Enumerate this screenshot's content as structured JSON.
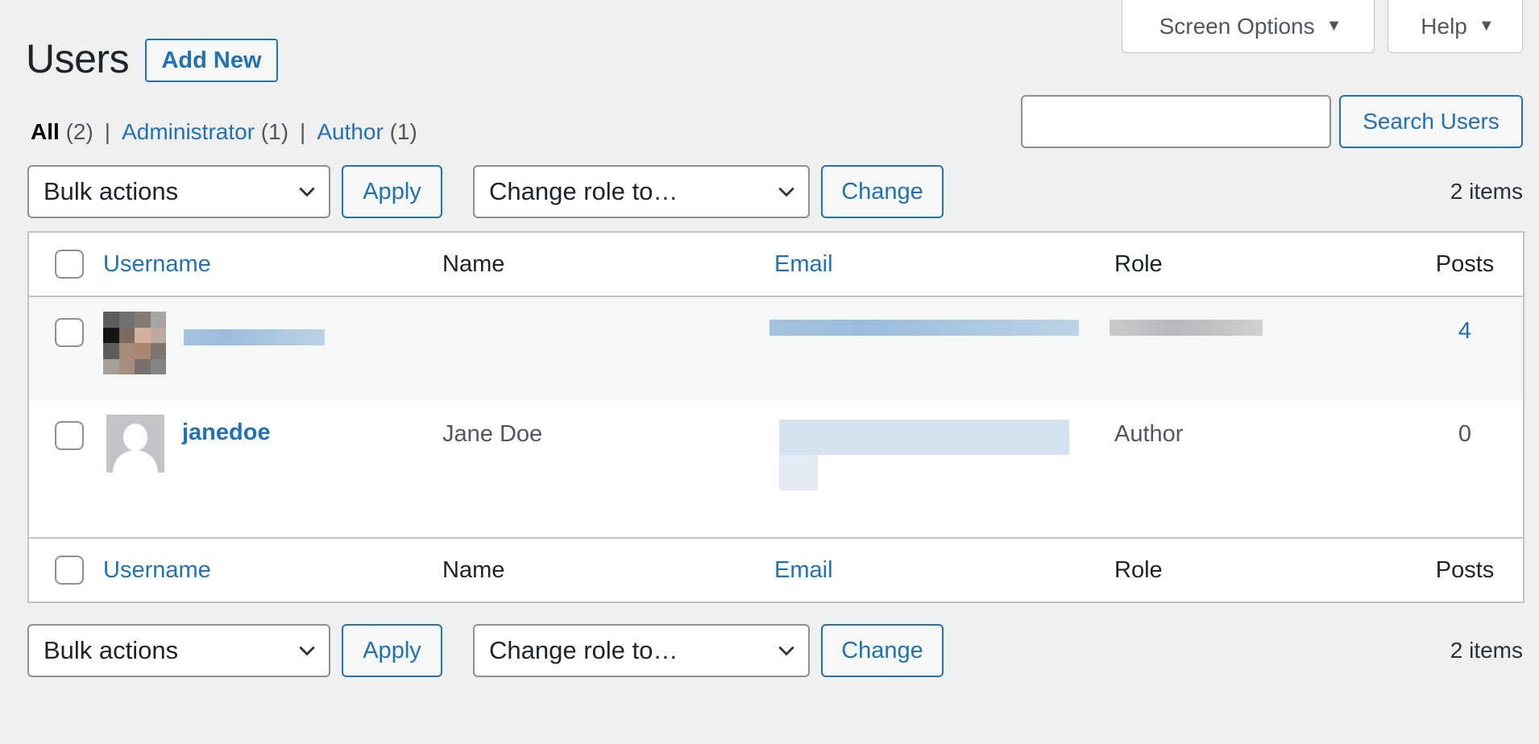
{
  "screen_meta": {
    "screen_options_label": "Screen Options",
    "help_label": "Help",
    "toggle_glyph": "▼"
  },
  "header": {
    "title": "Users",
    "add_new_label": "Add New"
  },
  "filters": [
    {
      "label": "All",
      "count": "(2)",
      "current": true
    },
    {
      "label": "Administrator",
      "count": "(1)",
      "current": false
    },
    {
      "label": "Author",
      "count": "(1)",
      "current": false
    }
  ],
  "filter_separator": "|",
  "search": {
    "value": "",
    "placeholder": "",
    "button_label": "Search Users"
  },
  "tablenav": {
    "bulk_actions_selected": "Bulk actions",
    "apply_label": "Apply",
    "change_role_selected": "Change role to…",
    "change_label": "Change",
    "items_count": "2 items"
  },
  "table": {
    "columns": [
      "Username",
      "Name",
      "Email",
      "Role",
      "Posts"
    ],
    "rows": [
      {
        "username": "[redacted]",
        "name": "",
        "email": "[redacted]",
        "role": "[redacted]",
        "posts": "4",
        "avatar": "photo-avatar (pixelated)",
        "redacted": true
      },
      {
        "username": "janedoe",
        "name": "Jane Doe",
        "email": "[redacted]",
        "role": "Author",
        "posts": "0",
        "avatar": "default-avatar",
        "redacted": false
      }
    ]
  },
  "colors": {
    "accent": "#2271b1",
    "background": "#f0f0f1",
    "border": "#c3c4c7",
    "alt_row": "#f6f7f7",
    "text": "#1d2327"
  }
}
